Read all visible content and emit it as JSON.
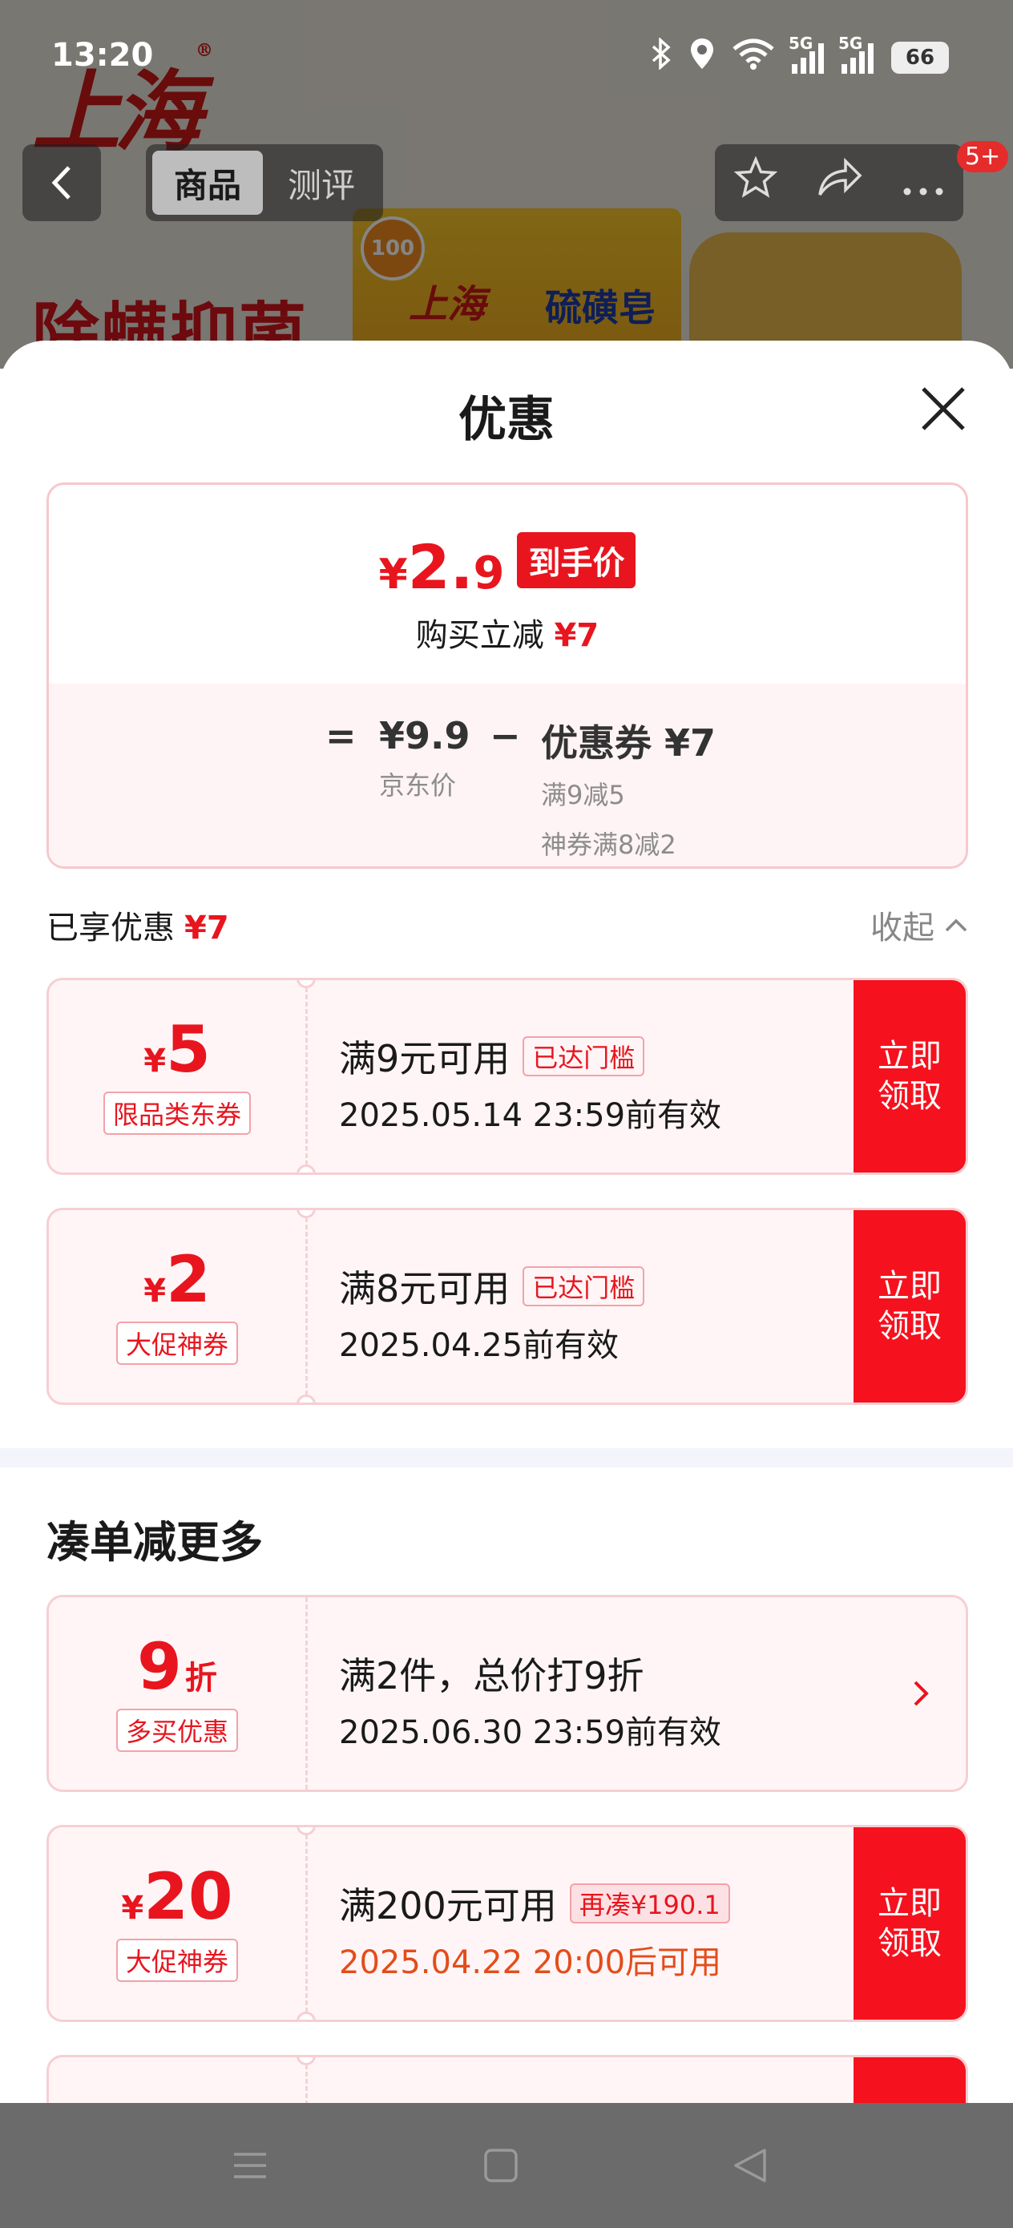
{
  "status_bar": {
    "time": "13:20",
    "battery": "66",
    "network_1": "5G",
    "network_2": "5G"
  },
  "background_page": {
    "brand": "上海",
    "promo_text": "除螨抑菌",
    "pack_brand": "上海",
    "pack_name": "硫磺皂",
    "pack_logo": "100",
    "tabs": [
      {
        "label": "商品",
        "active": true
      },
      {
        "label": "测评",
        "active": false
      }
    ],
    "cart_badge": "5+"
  },
  "sheet": {
    "title": "优惠",
    "final_price": {
      "currency": "¥",
      "integer": "2.",
      "decimal": "9",
      "tag": "到手价"
    },
    "reduction": {
      "label": "购买立减",
      "amount": "¥7"
    },
    "formula": {
      "equals": "=",
      "price": "¥9.9",
      "price_label": "京东价",
      "minus": "−",
      "coupon": "优惠券 ¥7",
      "coupon_detail_1": "满9减5",
      "coupon_detail_2": "神券满8减2"
    },
    "enjoyed": {
      "label": "已享优惠",
      "amount": "¥7",
      "collapse": "收起"
    },
    "coupons": [
      {
        "currency": "¥",
        "amount": "5",
        "type": "限品类东券",
        "condition": "满9元可用",
        "tag": "已达门槛",
        "validity": "2025.05.14 23:59前有效",
        "button": "立即\n领取"
      },
      {
        "currency": "¥",
        "amount": "2",
        "type": "大促神券",
        "condition": "满8元可用",
        "tag": "已达门槛",
        "validity": "2025.04.25前有效",
        "button": "立即\n领取"
      }
    ],
    "more_section": {
      "title": "凑单减更多",
      "offers": [
        {
          "amount": "9",
          "unit": "折",
          "type": "多买优惠",
          "condition": "满2件，总价打9折",
          "validity": "2025.06.30 23:59前有效"
        },
        {
          "currency": "¥",
          "amount": "20",
          "type": "大促神券",
          "condition": "满200元可用",
          "tag": "再凑¥190.1",
          "validity": "2025.04.22 20:00后可用",
          "button": "立即\n领取"
        }
      ]
    }
  },
  "colors": {
    "accent": "#e8151e",
    "button": "#f5121e",
    "coupon_bg": "#fff5f6",
    "orange_text": "#e34d1a"
  }
}
